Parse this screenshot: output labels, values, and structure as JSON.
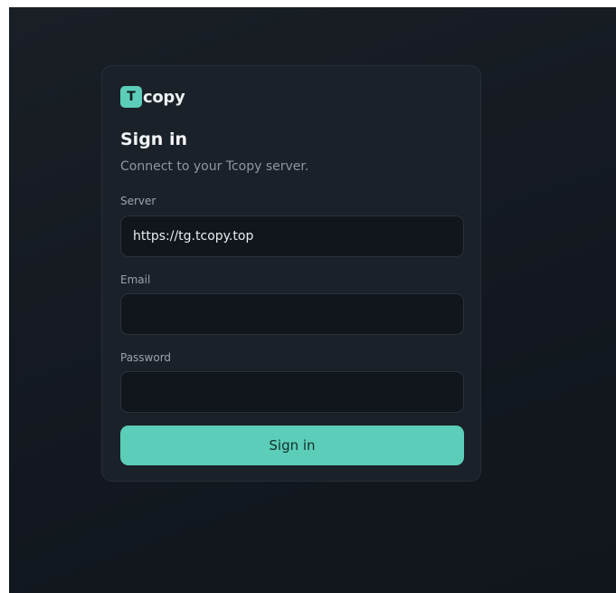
{
  "brand": {
    "logo_letter": "T",
    "logo_text": "copy",
    "accent_color": "#5ccdb9"
  },
  "header": {
    "title": "Sign in",
    "subtitle": "Connect to your Tcopy server."
  },
  "form": {
    "server": {
      "label": "Server",
      "value": "https://tg.tcopy.top",
      "placeholder": ""
    },
    "email": {
      "label": "Email",
      "value": "",
      "placeholder": ""
    },
    "password": {
      "label": "Password",
      "value": "",
      "placeholder": ""
    },
    "submit_label": "Sign in"
  }
}
